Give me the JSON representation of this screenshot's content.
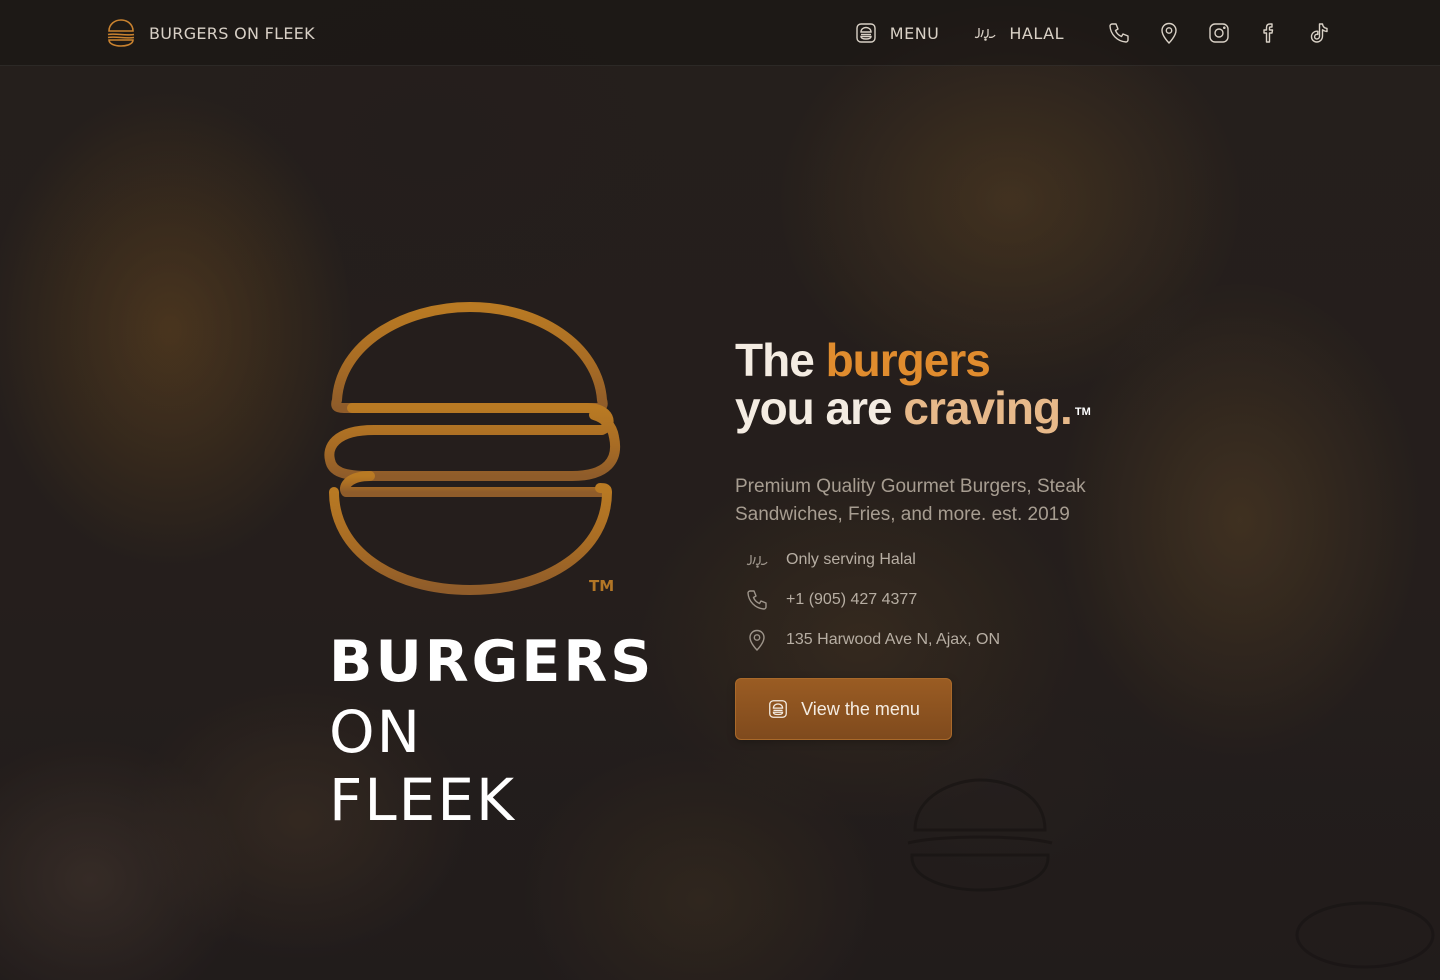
{
  "header": {
    "brand": "BURGERS ON FLEEK",
    "nav": {
      "menu_label": "MENU",
      "halal_label": "HALAL"
    },
    "icons": [
      "phone-icon",
      "location-pin-icon",
      "instagram-icon",
      "facebook-icon",
      "tiktok-icon"
    ]
  },
  "logo": {
    "tm": "TM",
    "line1": "BURGERS",
    "line2": "ON FLEEK"
  },
  "hero": {
    "headline": {
      "the": "The",
      "burgers": "burgers",
      "you_are": "you are",
      "craving": "craving.",
      "tm": "TM"
    },
    "lede": "Premium Quality Gourmet Burgers, Steak Sandwiches, Fries, and more. est. 2019",
    "facts": [
      {
        "icon": "halal-icon",
        "text": "Only serving Halal"
      },
      {
        "icon": "phone-icon",
        "text": "+1 (905) 427 4377"
      },
      {
        "icon": "location-pin-icon",
        "text": "135 Harwood Ave N, Ajax, ON"
      }
    ],
    "cta_label": "View the menu"
  },
  "colors": {
    "accent_orange": "#e08c2e",
    "accent_tan": "#e7b98a",
    "logo_gold": "#b27626",
    "button": "#8a5220",
    "background": "#2a2420"
  }
}
